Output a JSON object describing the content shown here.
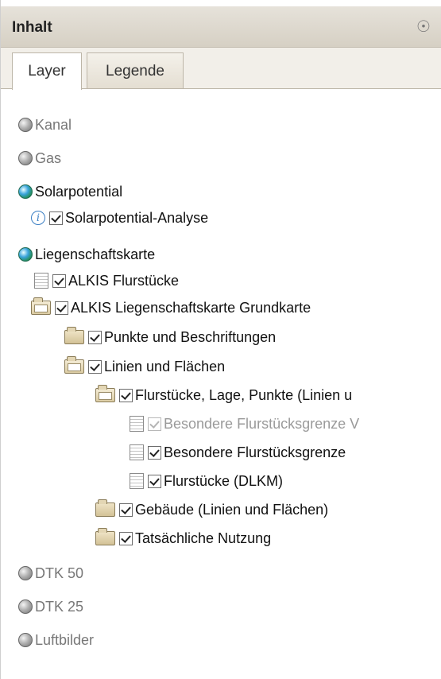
{
  "header": {
    "title": "Inhalt",
    "collapse_icon": "collapse-circle-icon"
  },
  "tabs": [
    {
      "label": "Layer",
      "active": true
    },
    {
      "label": "Legende",
      "active": false
    }
  ],
  "tree": {
    "kanal": "Kanal",
    "gas": "Gas",
    "solarpotential": "Solarpotential",
    "solarpotential_analyse": "Solarpotential-Analyse",
    "liegenschaftskarte": "Liegenschaftskarte",
    "alkis_flurstuecke": "ALKIS Flurstücke",
    "alkis_grundkarte": "ALKIS Liegenschaftskarte Grundkarte",
    "punkte_beschriftungen": "Punkte und Beschriftungen",
    "linien_flaechen": "Linien und Flächen",
    "flurstuecke_lage_punkte": "Flurstücke, Lage, Punkte (Linien u",
    "besondere_grenze_v": "Besondere Flurstücksgrenze V",
    "besondere_grenze": "Besondere Flurstücksgrenze",
    "flurstuecke_dlkm": "Flurstücke (DLKM)",
    "gebaeude": "Gebäude (Linien und Flächen)",
    "tatsaechliche_nutzung": "Tatsächliche Nutzung",
    "dtk50": "DTK 50",
    "dtk25": "DTK 25",
    "luftbilder": "Luftbilder"
  },
  "colors": {
    "header_bg": "#d6d0c4",
    "active_globe": "#2a9a4a",
    "info_icon": "#3b7fc4"
  }
}
